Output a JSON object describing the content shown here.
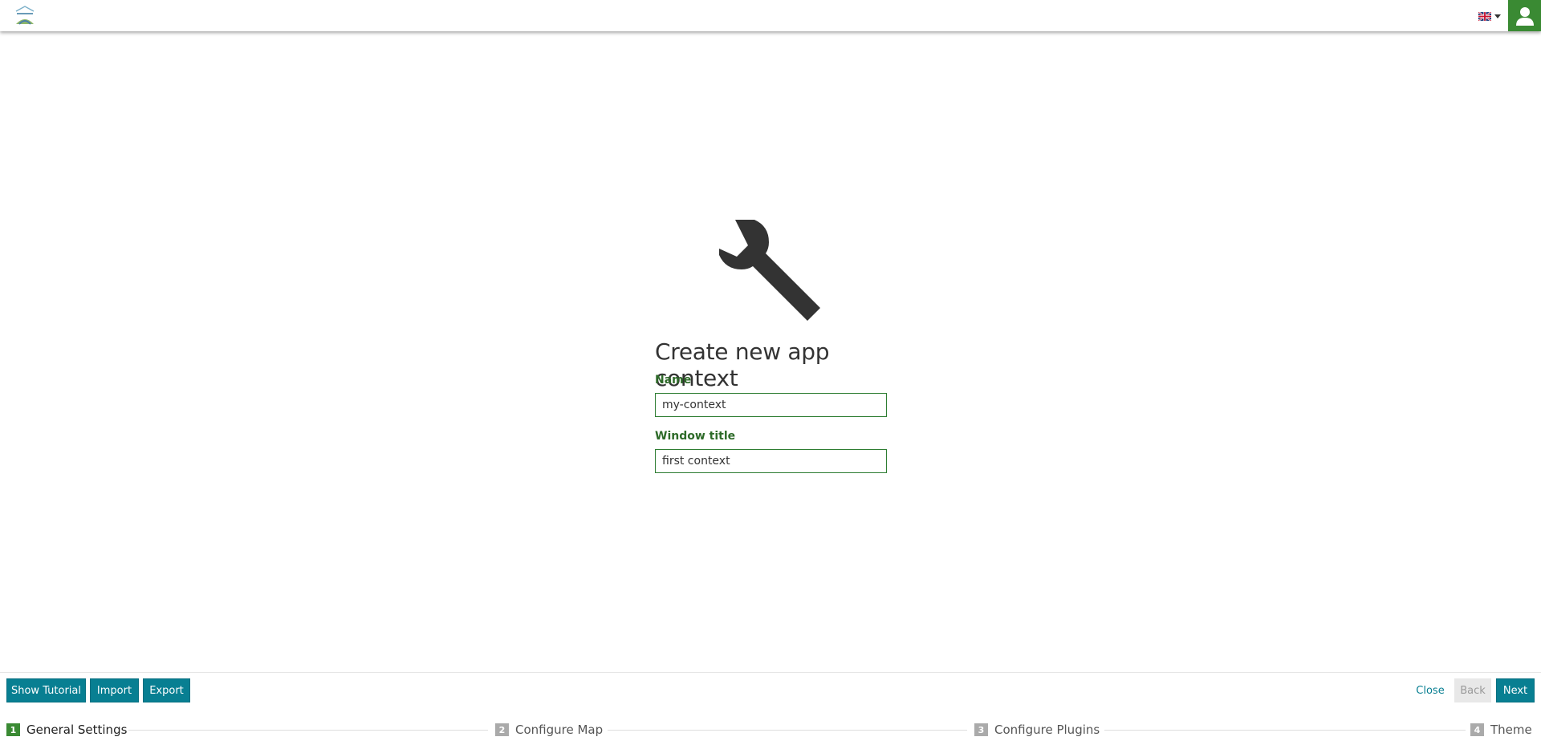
{
  "topbar": {
    "logo_name": "mapstore-logo",
    "language_icon": "uk-flag-icon",
    "user_icon": "user-icon"
  },
  "main": {
    "icon": "wrench-icon",
    "title": "Create new app context",
    "name_label": "Name",
    "name_value": "my-context",
    "window_title_label": "Window title",
    "window_title_value": "first context"
  },
  "footer": {
    "show_tutorial": "Show Tutorial",
    "import": "Import",
    "export": "Export",
    "close": "Close",
    "back": "Back",
    "next": "Next"
  },
  "steps": [
    {
      "num": "1",
      "label": "General Settings",
      "active": true
    },
    {
      "num": "2",
      "label": "Configure Map",
      "active": false
    },
    {
      "num": "3",
      "label": "Configure Plugins",
      "active": false
    },
    {
      "num": "4",
      "label": "Theme",
      "active": false
    }
  ],
  "colors": {
    "accent_green": "#3a8a33",
    "button_teal": "#087f92",
    "label_green": "#2e6b29"
  }
}
